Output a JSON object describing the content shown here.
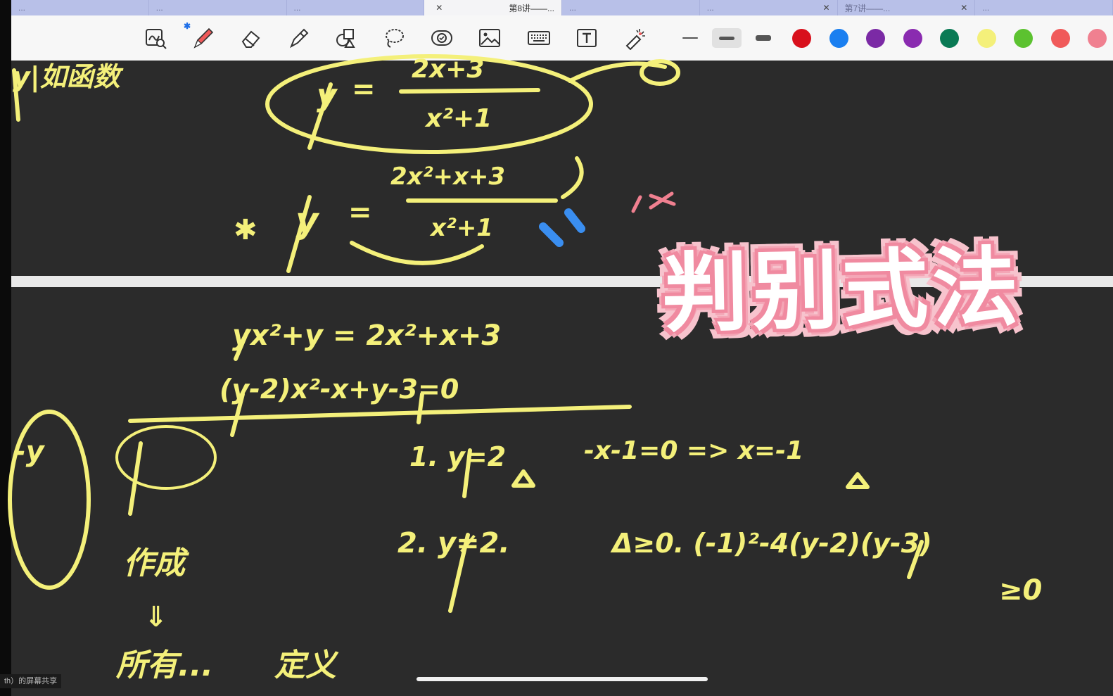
{
  "tabs": [
    {
      "label": "...",
      "active": false
    },
    {
      "label": "...",
      "active": false
    },
    {
      "label": "...",
      "active": false
    },
    {
      "label": "第8讲——...",
      "active": true
    },
    {
      "label": "...",
      "active": false
    },
    {
      "label": "...",
      "active": false
    },
    {
      "label": "第7讲——...",
      "active": false
    },
    {
      "label": "...",
      "active": false
    }
  ],
  "toolbar": {
    "tools": [
      "lasso-zoom-icon",
      "pen-icon",
      "eraser-icon",
      "highlighter-icon",
      "shapes-icon",
      "lasso-icon",
      "sticker-icon",
      "image-icon",
      "keyboard-icon",
      "textbox-icon",
      "laser-pointer-icon"
    ],
    "bluetooth_mark": "✱",
    "stroke_widths": [
      "thin",
      "medium",
      "thick"
    ],
    "selected_stroke": 1,
    "colors": [
      "#d8101c",
      "#1a7ff0",
      "#7b2aa5",
      "#8a2bb0",
      "#0a7a55",
      "#f4f07a",
      "#5cc230",
      "#f05a5a",
      "#f08090"
    ]
  },
  "board": {
    "top_frac_num": "2x+3",
    "top_frac_den": "x²+1",
    "second_num": "2x²+x+3",
    "second_den": "x²+1",
    "heading": "判别式法",
    "eq1": "yx²+y = 2x²+x+3",
    "eq2": "(y-2)x²-x+y-3=0",
    "case1": "1. y=2",
    "case1b": "-x-1=0 => x=-1",
    "case2": "2. y≠2.",
    "case2b": "Δ≥0. (-1)²-4(y-2)(y-3)",
    "case2c": "≥0",
    "note_top_left": "y|如函数",
    "side1": "作成",
    "side2": "所有...",
    "side3": "定义"
  },
  "share_label": "th）的屏幕共享"
}
